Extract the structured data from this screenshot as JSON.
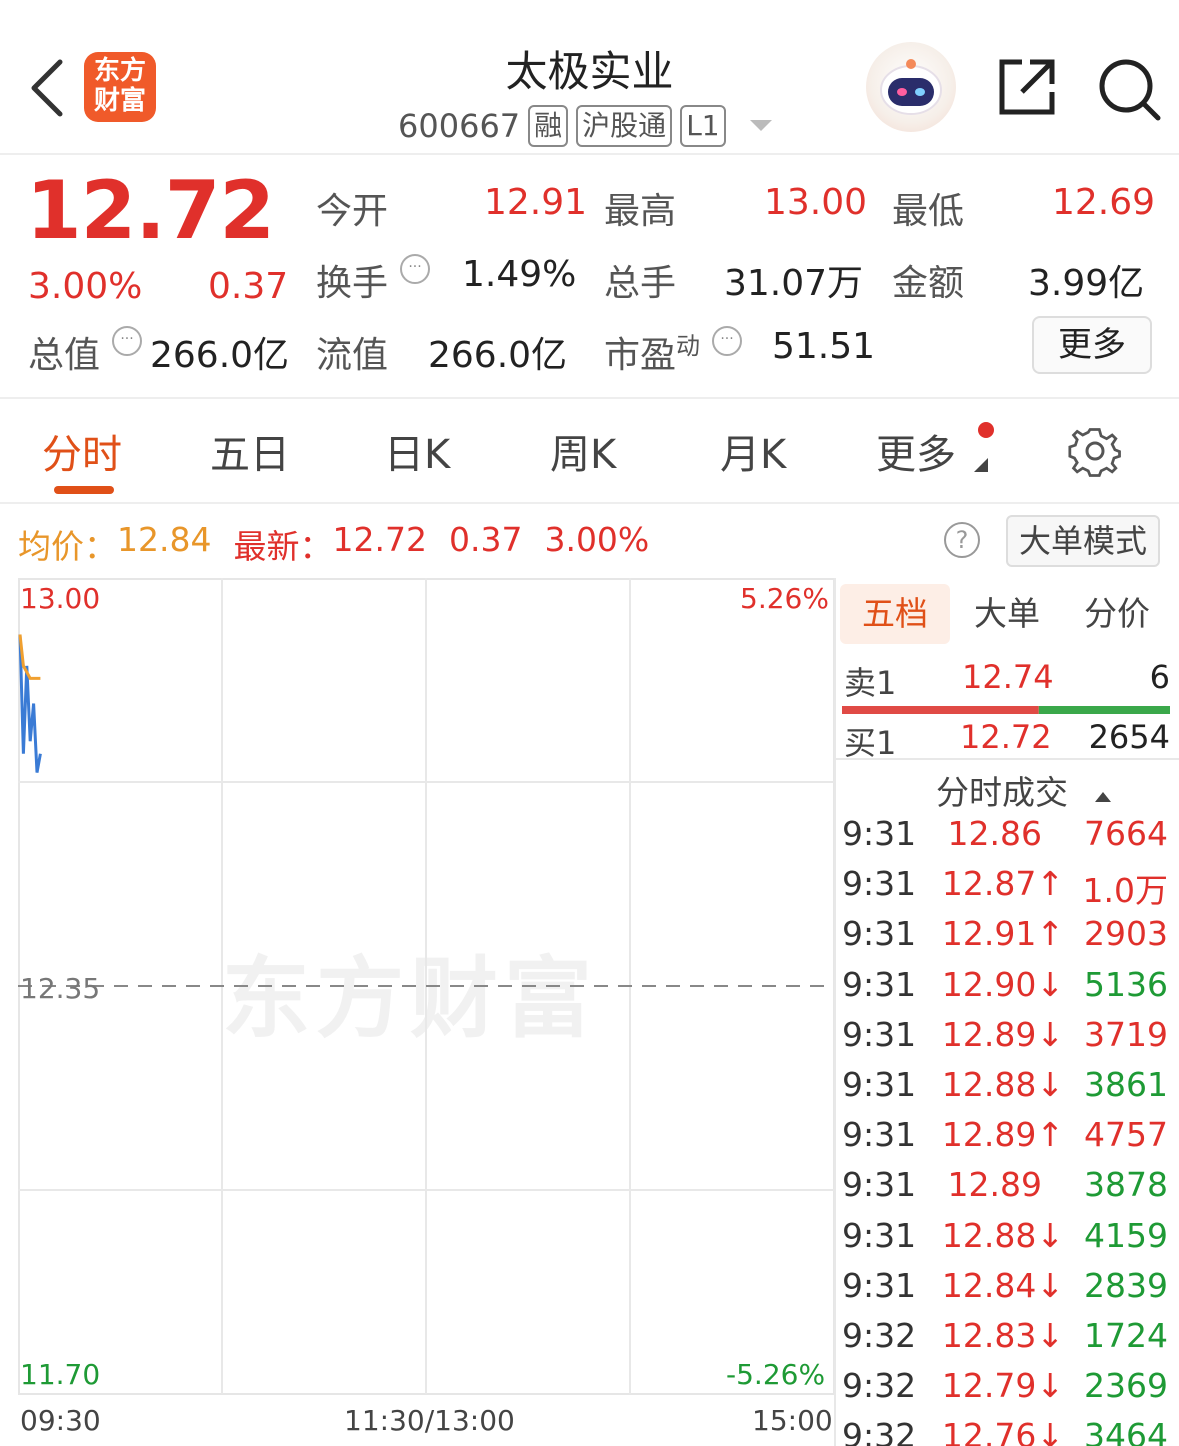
{
  "header": {
    "logo_text_line1": "东方",
    "logo_text_line2": "财富",
    "stock_name": "太极实业",
    "stock_code": "600667",
    "tags": [
      "融",
      "沪股通",
      "L1"
    ]
  },
  "quote": {
    "price": "12.72",
    "change_pct": "3.00%",
    "change": "0.37",
    "fields": [
      {
        "label": "今开",
        "value": "12.91",
        "color": "red"
      },
      {
        "label": "最高",
        "value": "13.00",
        "color": "red"
      },
      {
        "label": "最低",
        "value": "12.69",
        "color": "red"
      },
      {
        "label": "换手",
        "value": "1.49%",
        "color": "dark"
      },
      {
        "label": "总手",
        "value": "31.07万",
        "color": "dark"
      },
      {
        "label": "金额",
        "value": "3.99亿",
        "color": "dark"
      },
      {
        "label": "总值",
        "value": "266.0亿",
        "color": "dark"
      },
      {
        "label": "流值",
        "value": "266.0亿",
        "color": "dark"
      },
      {
        "label": "市盈",
        "value": "51.51",
        "color": "dark"
      }
    ],
    "pe_superscript": "动",
    "more_button": "更多"
  },
  "tabs": [
    "分时",
    "五日",
    "日K",
    "周K",
    "月K",
    "更多"
  ],
  "info_bar": {
    "avg_label": "均价：",
    "avg_value": "12.84",
    "latest_label": "最新：",
    "latest_value": "12.72",
    "latest_change": "0.37",
    "latest_pct": "3.00%",
    "help": "?",
    "big_order_button": "大单模式"
  },
  "chart_data": {
    "type": "line",
    "y_labels": {
      "top": "13.00",
      "mid": "12.35",
      "bottom": "11.70"
    },
    "pct_labels": {
      "top": "5.26%",
      "bottom": "-5.26%"
    },
    "x_labels": [
      "09:30",
      "11:30/13:00",
      "15:00"
    ],
    "ylim": [
      11.7,
      13.0
    ],
    "prev_close": 12.35,
    "series": [
      {
        "values": [
          12.91,
          12.72,
          12.86,
          12.74,
          12.8,
          12.69,
          12.72
        ],
        "color": "#3a7bd5"
      },
      {
        "values": [
          12.91,
          12.86,
          12.85,
          12.84,
          12.84,
          12.84,
          12.84
        ],
        "color": "#f0a030"
      }
    ],
    "watermark": "东方财富"
  },
  "order_book": {
    "tabs": [
      "五档",
      "大单",
      "分价"
    ],
    "sell": {
      "label": "卖1",
      "price": "12.74",
      "volume": "6"
    },
    "buy": {
      "label": "买1",
      "price": "12.72",
      "volume": "2654"
    },
    "depth_sell_fraction": 0.6,
    "trades_title": "分时成交",
    "trades": [
      {
        "time": "9:31",
        "price": "12.86",
        "arrow": "",
        "vol": "7664",
        "pc": "red",
        "vc": "red"
      },
      {
        "time": "9:31",
        "price": "12.87",
        "arrow": "↑",
        "vol": "1.0万",
        "pc": "red",
        "vc": "red"
      },
      {
        "time": "9:31",
        "price": "12.91",
        "arrow": "↑",
        "vol": "2903",
        "pc": "red",
        "vc": "red"
      },
      {
        "time": "9:31",
        "price": "12.90",
        "arrow": "↓",
        "vol": "5136",
        "pc": "red",
        "vc": "green"
      },
      {
        "time": "9:31",
        "price": "12.89",
        "arrow": "↓",
        "vol": "3719",
        "pc": "red",
        "vc": "red"
      },
      {
        "time": "9:31",
        "price": "12.88",
        "arrow": "↓",
        "vol": "3861",
        "pc": "red",
        "vc": "green"
      },
      {
        "time": "9:31",
        "price": "12.89",
        "arrow": "↑",
        "vol": "4757",
        "pc": "red",
        "vc": "red"
      },
      {
        "time": "9:31",
        "price": "12.89",
        "arrow": "",
        "vol": "3878",
        "pc": "red",
        "vc": "green"
      },
      {
        "time": "9:31",
        "price": "12.88",
        "arrow": "↓",
        "vol": "4159",
        "pc": "red",
        "vc": "green"
      },
      {
        "time": "9:31",
        "price": "12.84",
        "arrow": "↓",
        "vol": "2839",
        "pc": "red",
        "vc": "green"
      },
      {
        "time": "9:32",
        "price": "12.83",
        "arrow": "↓",
        "vol": "1724",
        "pc": "red",
        "vc": "green"
      },
      {
        "time": "9:32",
        "price": "12.79",
        "arrow": "↓",
        "vol": "2369",
        "pc": "red",
        "vc": "green"
      },
      {
        "time": "9:32",
        "price": "12.76",
        "arrow": "↓",
        "vol": "3464",
        "pc": "red",
        "vc": "green"
      }
    ]
  },
  "colors": {
    "red": "#e0302b",
    "green": "#1e9a35",
    "orange": "#f0a030",
    "accent": "#e05018",
    "blue": "#3a7bd5"
  }
}
